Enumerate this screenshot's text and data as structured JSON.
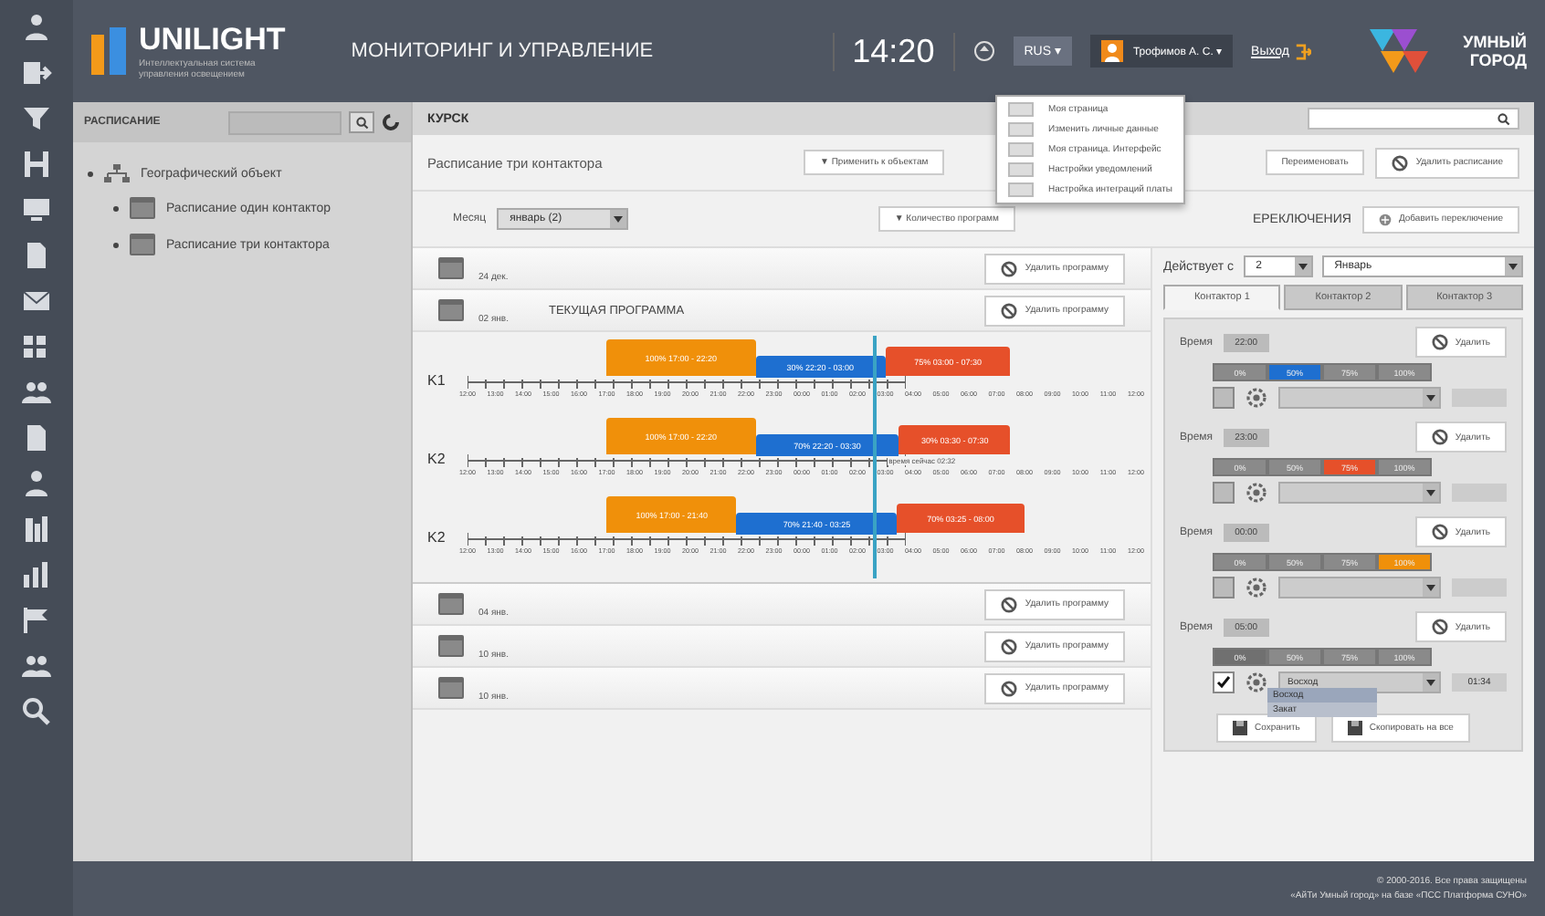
{
  "header": {
    "logo": "UNILIGHT",
    "logo_subtitle": "Интеллектуальная система управления освещением",
    "title": "МОНИТОРИНГ И УПРАВЛЕНИЕ",
    "time": "14:20",
    "language": "RUS ▾",
    "user": "Трофимов А. С. ▾",
    "logout": "Выход",
    "brand": "УМНЫЙ ГОРОД"
  },
  "user_menu": [
    "Моя страница",
    "Изменить личные данные",
    "Моя страница. Интерфейс",
    "Настройки уведомлений",
    "Настройка интеграций платы"
  ],
  "sidebar": {
    "title": "РАСПИСАНИЕ",
    "tree": [
      {
        "label": "Географический объект",
        "children": [
          {
            "label": "Расписание один контактор"
          },
          {
            "label": "Расписание три контактора"
          }
        ]
      }
    ]
  },
  "main": {
    "city": "КУРСК",
    "schedule_title": "Расписание три контактора",
    "toolbar_1": [
      "▼ Применить к объектам",
      "Переименовать",
      "Удалить расписание"
    ],
    "month_label": "Месяц",
    "month": "январь (2)",
    "programs_count": "▼ Количество программ",
    "switch_title": "ЕРЕКЛЮЧЕНИЯ",
    "add_switch": "Добавить переключение",
    "programs": [
      {
        "date": "24 дек.",
        "delete": "Удалить программу"
      },
      {
        "date": "02 янв.",
        "current": "ТЕКУЩАЯ ПРОГРАММА",
        "delete": "Удалить программу",
        "now": {
          "prefix": "время сейчас",
          "time": "02:32"
        },
        "timelines": [
          {
            "label": "K1",
            "segments": [
              {
                "label": "100% 17:00 - 22:20",
                "kind": "high",
                "color": "#f0900a"
              },
              {
                "label": "30% 22:20 - 03:00",
                "kind": "low",
                "color": "#1e6fd0"
              },
              {
                "label": "75% 03:00 - 07:30",
                "kind": "mid",
                "color": "#e6502a"
              }
            ],
            "ticks": [
              "12:00",
              "13:00",
              "14:00",
              "15:00",
              "16:00",
              "17:00",
              "18:00",
              "19:00",
              "20:00",
              "21:00",
              "22:00",
              "23:00",
              "00:00",
              "01:00",
              "02:00",
              "03:00",
              "04:00",
              "05:00",
              "06:00",
              "07:00",
              "08:00",
              "09:00",
              "10:00",
              "11:00",
              "12:00"
            ]
          },
          {
            "label": "K2",
            "segments": [
              {
                "label": "100% 17:00 - 22:20",
                "kind": "high",
                "color": "#f0900a"
              },
              {
                "label": "70% 22:20 - 03:30",
                "kind": "low",
                "color": "#1e6fd0"
              },
              {
                "label": "30% 03:30 - 07:30",
                "kind": "mid",
                "color": "#e6502a"
              }
            ],
            "ticks": [
              "12:00",
              "13:00",
              "14:00",
              "15:00",
              "16:00",
              "17:00",
              "18:00",
              "19:00",
              "20:00",
              "21:00",
              "22:00",
              "23:00",
              "00:00",
              "01:00",
              "02:00",
              "03:00",
              "04:00",
              "05:00",
              "06:00",
              "07:00",
              "08:00",
              "09:00",
              "10:00",
              "11:00",
              "12:00"
            ]
          },
          {
            "label": "K2",
            "segments": [
              {
                "label": "100% 17:00 - 21:40",
                "kind": "high",
                "color": "#f0900a"
              },
              {
                "label": "70% 21:40 - 03:25",
                "kind": "low",
                "color": "#1e6fd0"
              },
              {
                "label": "70% 03:25 - 08:00",
                "kind": "mid",
                "color": "#e6502a"
              }
            ],
            "ticks": [
              "12:00",
              "13:00",
              "14:00",
              "15:00",
              "16:00",
              "17:00",
              "18:00",
              "19:00",
              "20:00",
              "21:00",
              "22:00",
              "23:00",
              "00:00",
              "01:00",
              "02:00",
              "03:00",
              "04:00",
              "05:00",
              "06:00",
              "07:00",
              "08:00",
              "09:00",
              "10:00",
              "11:00",
              "12:00"
            ]
          }
        ]
      },
      {
        "date": "04 янв.",
        "delete": "Удалить программу"
      },
      {
        "date": "10 янв.",
        "delete": "Удалить программу"
      },
      {
        "date": "10 янв.",
        "delete": "Удалить программу"
      }
    ]
  },
  "panel": {
    "valid_from": "Действует с",
    "day": "2",
    "month": "Январь",
    "tabs": [
      {
        "label": "Контактор 1",
        "selected": true
      },
      {
        "label": "Контактор 2",
        "selected": false
      },
      {
        "label": "Контактор 3",
        "selected": false
      }
    ],
    "blocks": [
      {
        "label": "Время",
        "time": "22:00",
        "delete": "Удалить",
        "color": "#1e6fd0",
        "checked": false,
        "options": [
          {
            "label": "0%",
            "selected": false
          },
          {
            "label": "50%",
            "selected": true
          },
          {
            "label": "75%",
            "selected": false
          },
          {
            "label": "100%",
            "selected": false
          }
        ]
      },
      {
        "label": "Время",
        "time": "23:00",
        "delete": "Удалить",
        "color": "#e6502a",
        "checked": false,
        "options": [
          {
            "label": "0%",
            "selected": false
          },
          {
            "label": "50%",
            "selected": false
          },
          {
            "label": "75%",
            "selected": true
          },
          {
            "label": "100%",
            "selected": false
          }
        ]
      },
      {
        "label": "Время",
        "time": "00:00",
        "delete": "Удалить",
        "color": "#f0900a",
        "checked": false,
        "options": [
          {
            "label": "0%",
            "selected": false
          },
          {
            "label": "50%",
            "selected": false
          },
          {
            "label": "75%",
            "selected": false
          },
          {
            "label": "100%",
            "selected": true
          }
        ]
      },
      {
        "label": "Время",
        "time": "05:00",
        "delete": "Удалить",
        "color": "#707070",
        "checked": true,
        "select": "Восход",
        "value": "01:34",
        "dropdown": [
          {
            "label": "Восход",
            "selected": true
          },
          {
            "label": "Закат",
            "selected": false
          }
        ],
        "options": [
          {
            "label": "0%",
            "selected": true
          },
          {
            "label": "50%",
            "selected": false
          },
          {
            "label": "75%",
            "selected": false
          },
          {
            "label": "100%",
            "selected": false
          }
        ]
      }
    ],
    "save": "Сохранить",
    "copy_all": "Скопировать на все"
  },
  "footer": [
    "© 2000-2016. Все права защищены",
    "«АйТи Умный город» на базе «ПСС Платформа СУНО»"
  ]
}
